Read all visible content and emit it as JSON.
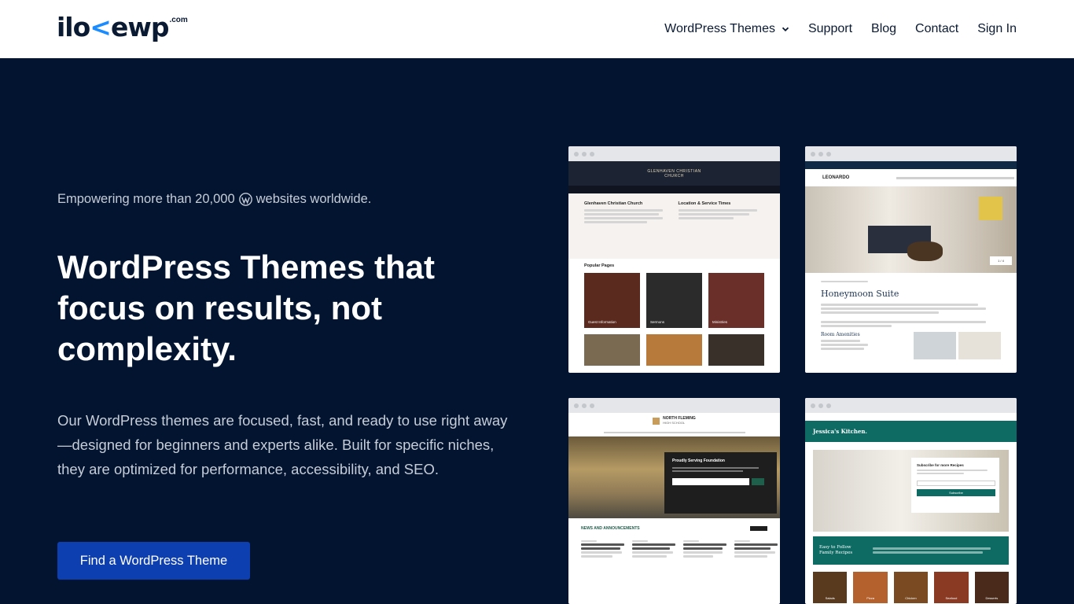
{
  "header": {
    "logo_main_a": "ilo",
    "logo_arrow": "<",
    "logo_main_b": "ewp",
    "logo_tld": ".com",
    "nav": [
      {
        "label": "WordPress Themes",
        "has_dropdown": true
      },
      {
        "label": "Support"
      },
      {
        "label": "Blog"
      },
      {
        "label": "Contact"
      },
      {
        "label": "Sign In"
      }
    ]
  },
  "hero": {
    "tagline_before": "Empowering more than 20,000",
    "tagline_after": "websites worldwide.",
    "headline": "WordPress Themes that focus on results, not complexity.",
    "description": "Our WordPress themes are focused, fast, and ready to use right away—designed for beginners and experts alike. Built for specific niches, they are optimized for performance, accessibility, and SEO.",
    "cta_label": "Find a WordPress Theme"
  },
  "thumbnails": {
    "church": {
      "site_name": "GLENHAVEN CHRISTIAN CHURCH",
      "col1_title": "Glenhaven Christian Church",
      "col2_title": "Location & Service Times",
      "section": "Popular Pages",
      "tiles": [
        "Guest Information",
        "Sermons",
        "Ministries"
      ]
    },
    "hotel": {
      "brand": "LEONARDO",
      "room_title": "Honeymoon Suite",
      "section": "Room Amenities",
      "slider": "1 / 4"
    },
    "school": {
      "brand_line1": "NORTH FLEMING",
      "brand_line2": "HIGH SCHOOL",
      "panel_title": "Proudly Serving Foundation",
      "news_title": "NEWS AND ANNOUNCEMENTS"
    },
    "kitchen": {
      "brand": "Jessica's Kitchen.",
      "subscribe_title": "Subscribe for more Recipes",
      "subscribe_btn": "Subscribe",
      "banner": "Easy to Follow Family Recipes",
      "categories": [
        "Salads",
        "Pizza",
        "Chicken",
        "Seafood",
        "Desserts"
      ]
    }
  },
  "colors": {
    "background": "#02142f",
    "cta": "#0d3fb0",
    "accent": "#1a8cff",
    "kitchen_teal": "#0e6b64"
  }
}
